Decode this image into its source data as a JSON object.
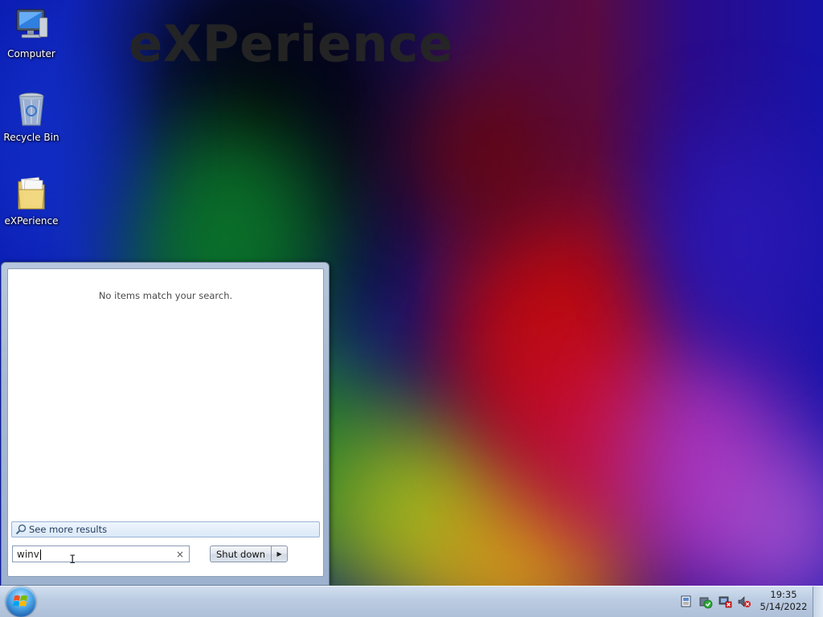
{
  "wallpaper": {
    "wordmark": "eXPerience"
  },
  "desktop_icons": [
    {
      "label": "Computer",
      "icon": "computer-icon"
    },
    {
      "label": "Recycle Bin",
      "icon": "recycle-bin-icon"
    },
    {
      "label": "eXPerience",
      "icon": "folder-icon"
    }
  ],
  "start_menu": {
    "no_results_text": "No items match your search.",
    "see_more_label": "See more results",
    "search_value": "winv",
    "clear_glyph": "×",
    "shutdown_label": "Shut down",
    "shutdown_arrow_glyph": "▶"
  },
  "taskbar": {
    "tray_icons": [
      "action-center-icon",
      "security-check-icon",
      "network-disconnected-icon",
      "volume-muted-icon"
    ],
    "clock_time": "19:35",
    "clock_date": "5/14/2022"
  },
  "colors": {
    "taskbar": "#bccde3",
    "start_menu_frame": "#a7b9d2",
    "see_more_bg": "#dbe9f8"
  }
}
